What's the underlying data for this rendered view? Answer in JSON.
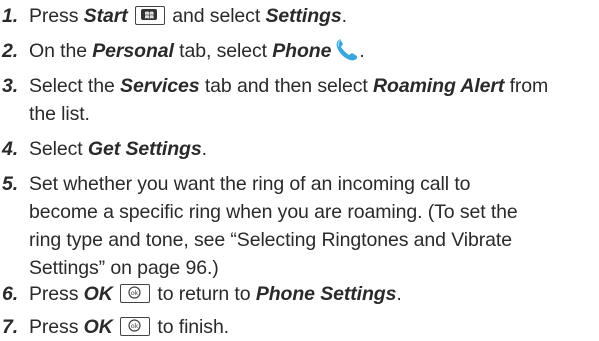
{
  "steps": [
    {
      "num": "1.",
      "parts": [
        "Press ",
        "Start",
        " ",
        " and select ",
        "Settings",
        "."
      ]
    },
    {
      "num": "2.",
      "parts": [
        "On the ",
        "Personal",
        " tab, select ",
        "Phone",
        "."
      ]
    },
    {
      "num": "3.",
      "parts": [
        "Select the ",
        "Services",
        " tab and then select ",
        "Roaming Alert",
        " from",
        "the list."
      ]
    },
    {
      "num": "4.",
      "parts": [
        "Select ",
        "Get Settings",
        "."
      ]
    },
    {
      "num": "5.",
      "lines": [
        "Set whether you want the ring of an incoming call to",
        "become a specific ring when you are roaming. (To set the",
        "ring type and tone, see “Selecting Ringtones and Vibrate",
        "Settings” on page 96.)"
      ]
    },
    {
      "num": "6.",
      "parts": [
        "Press ",
        "OK",
        " ",
        " to return to ",
        "Phone Settings",
        "."
      ]
    },
    {
      "num": "7.",
      "parts": [
        "Press ",
        "OK",
        " ",
        " to finish."
      ]
    }
  ],
  "icons": {
    "start_key": "windows-start-key-icon",
    "ok_key": "ok-key-icon",
    "phone": "phone-handset-icon"
  },
  "colors": {
    "text": "#2a2a2a",
    "phone_icon": "#3aa6e0"
  }
}
